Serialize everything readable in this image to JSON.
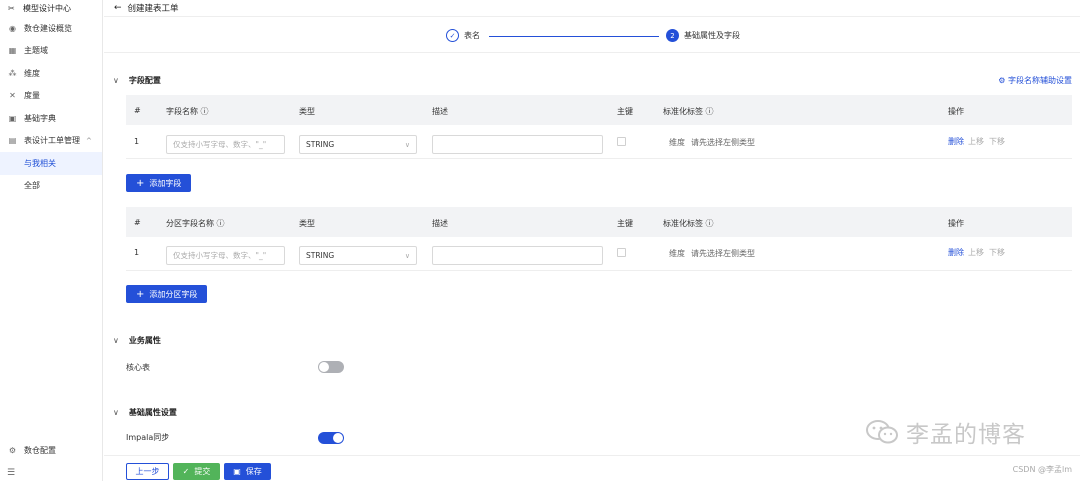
{
  "sidebar": {
    "brand": "模型设计中心",
    "items": [
      {
        "label": "数仓建设概览",
        "icon": "dashboard-icon"
      },
      {
        "label": "主题域",
        "icon": "grid-icon"
      },
      {
        "label": "维度",
        "icon": "hierarchy-icon"
      },
      {
        "label": "度量",
        "icon": "tools-icon"
      },
      {
        "label": "基础字典",
        "icon": "book-icon"
      },
      {
        "label": "表设计工单管理",
        "icon": "table-icon"
      }
    ],
    "sub_items": [
      "与我相关",
      "全部"
    ],
    "bottom_item": "数仓配置"
  },
  "header": {
    "title": "创建建表工单"
  },
  "steps": [
    {
      "label": "表名",
      "state": "done"
    },
    {
      "label": "基础属性及字段",
      "number": "2",
      "state": "active"
    }
  ],
  "field_config": {
    "title": "字段配置",
    "assist_link": "字段名称辅助设置",
    "columns": [
      "#",
      "字段名称",
      "类型",
      "描述",
      "主键",
      "标准化标签",
      "操作"
    ],
    "rows": [
      {
        "index": "1",
        "name_placeholder": "仅支持小写字母、数字、\"_\"",
        "type": "STRING",
        "tag_prefix": "维度",
        "tag_hint": "请先选择左侧类型",
        "ops": [
          "删除",
          "上移",
          "下移"
        ]
      }
    ],
    "add_button": "添加字段"
  },
  "partition_config": {
    "columns": [
      "#",
      "分区字段名称",
      "类型",
      "描述",
      "主键",
      "标准化标签",
      "操作"
    ],
    "rows": [
      {
        "index": "1",
        "name_placeholder": "仅支持小写字母、数字、\"_\"",
        "type": "STRING",
        "tag_prefix": "维度",
        "tag_hint": "请先选择左侧类型",
        "ops": [
          "删除",
          "上移",
          "下移"
        ]
      }
    ],
    "add_button": "添加分区字段"
  },
  "business": {
    "title": "业务属性",
    "core_table_label": "核心表",
    "core_table_on": false
  },
  "basic": {
    "title": "基础属性设置",
    "impala_label": "Impala同步",
    "impala_on": true
  },
  "footer": {
    "prev": "上一步",
    "submit": "提交",
    "save": "保存"
  },
  "watermark": "李孟的博客",
  "credit": "CSDN @李孟lm",
  "colors": {
    "primary": "#2450d8",
    "success": "#52b45a",
    "header_bg": "#f2f3f5",
    "active_bg": "#eef3ff"
  }
}
